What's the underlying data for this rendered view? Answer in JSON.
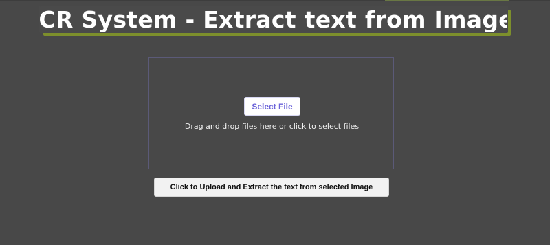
{
  "page": {
    "title": "OCR System - Extract text from Images"
  },
  "upload": {
    "select_button": "Select File",
    "drop_hint": "Drag and drop files here or click to select files",
    "submit_button": "Click to Upload and Extract the text from selected Image"
  },
  "colors": {
    "background": "#484848",
    "title_shadow": "#7d8f2c",
    "accent_text": "#6b63d9"
  }
}
